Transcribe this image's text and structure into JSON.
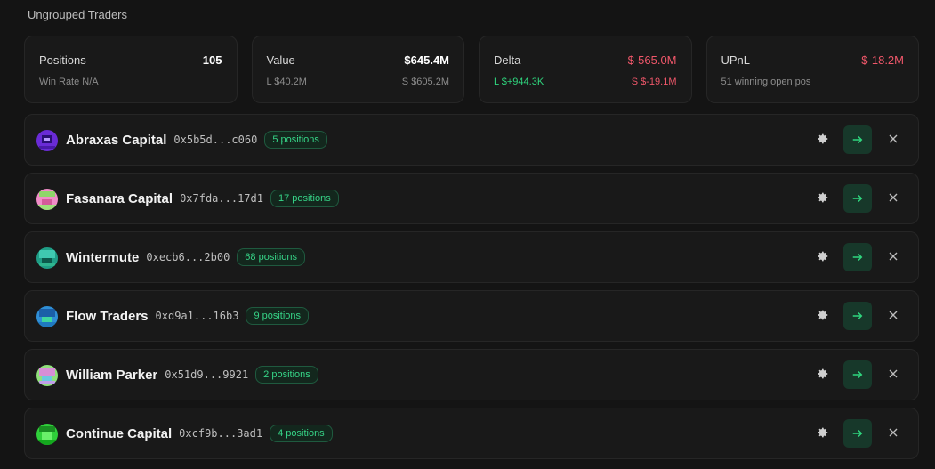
{
  "group": {
    "title": "Ungrouped Traders"
  },
  "stats": [
    {
      "label": "Positions",
      "value": "105",
      "sub_left": "Win Rate N/A",
      "sub_right": ""
    },
    {
      "label": "Value",
      "value": "$645.4M",
      "sub_left": "L $40.2M",
      "sub_right": "S $605.2M"
    },
    {
      "label": "Delta",
      "value": "$-565.0M",
      "sub_left": "L $+944.3K",
      "sub_right": "S $-19.1M"
    },
    {
      "label": "UPnL",
      "value": "$-18.2M",
      "sub_left": "51 winning open pos",
      "sub_right": ""
    }
  ],
  "colors": {
    "positive": "#2fd67e",
    "negative": "#f0576a",
    "accent": "#36d487"
  },
  "traders": [
    {
      "name": "Abraxas Capital",
      "address": "0x5b5d...c060",
      "positions": "5 positions",
      "avatar_icon": "pixel-avatar-icon"
    },
    {
      "name": "Fasanara Capital",
      "address": "0x7fda...17d1",
      "positions": "17 positions",
      "avatar_icon": "pixel-avatar-icon"
    },
    {
      "name": "Wintermute",
      "address": "0xecb6...2b00",
      "positions": "68 positions",
      "avatar_icon": "pixel-avatar-icon"
    },
    {
      "name": "Flow Traders",
      "address": "0xd9a1...16b3",
      "positions": "9 positions",
      "avatar_icon": "pixel-avatar-icon"
    },
    {
      "name": "William Parker",
      "address": "0x51d9...9921",
      "positions": "2 positions",
      "avatar_icon": "pixel-avatar-icon"
    },
    {
      "name": "Continue Capital",
      "address": "0xcf9b...3ad1",
      "positions": "4 positions",
      "avatar_icon": "pixel-avatar-icon"
    }
  ]
}
